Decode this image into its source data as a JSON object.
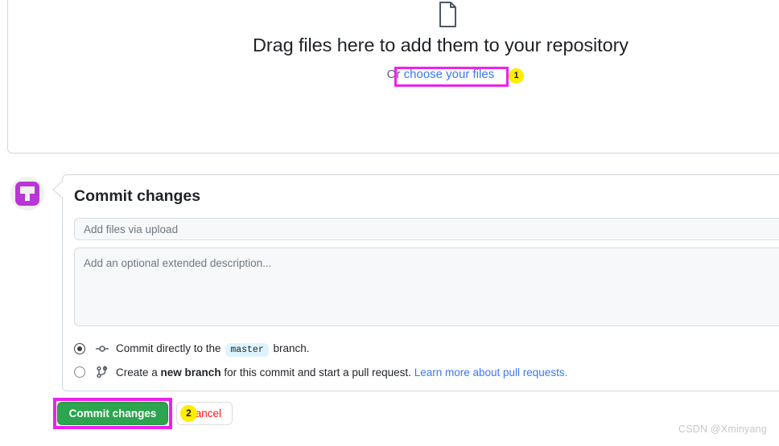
{
  "dropzone": {
    "file_icon_name": "file-document-icon",
    "title": "Drag files here to add them to your repository",
    "or_prefix": "Or ",
    "choose_link": "choose your files"
  },
  "annotations": [
    {
      "badge": "1",
      "target": "choose-your-files-link",
      "box_color": "#ee21ee",
      "badge_color": "#ffec00"
    },
    {
      "badge": "2",
      "target": "commit-changes-button",
      "box_color": "#ee21ee",
      "badge_color": "#ffec00"
    }
  ],
  "avatar": {
    "name": "user-avatar",
    "color": "#b935d6"
  },
  "commit_panel": {
    "heading": "Commit changes",
    "summary_placeholder": "Add files via upload",
    "summary_value": "",
    "description_placeholder": "Add an optional extended description...",
    "description_value": "",
    "options": [
      {
        "id": "commit-directly",
        "selected": true,
        "icon": "git-commit-icon",
        "text_before": "Commit directly to the",
        "branch_badge": "master",
        "text_after": "branch."
      },
      {
        "id": "create-new-branch",
        "selected": false,
        "icon": "git-branch-icon",
        "text_before": "Create a",
        "emphasis": "new branch",
        "text_middle": "for this commit and start a pull request.",
        "link": "Learn more about pull requests."
      }
    ],
    "commit_button_label": "Commit changes",
    "commit_button_color": "#2da44e",
    "cancel_button_label": "Cancel",
    "cancel_button_color": "#fa1616"
  },
  "watermark": "CSDN @Xminyang"
}
